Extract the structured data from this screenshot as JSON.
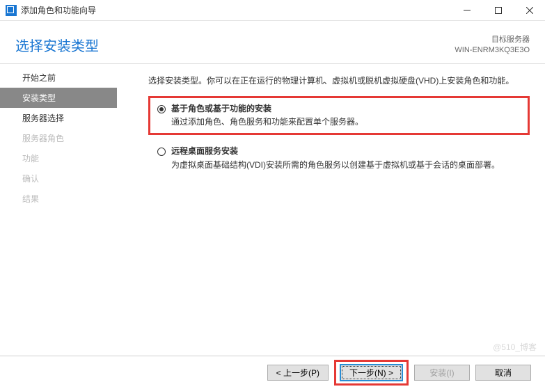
{
  "titlebar": {
    "title": "添加角色和功能向导"
  },
  "header": {
    "title": "选择安装类型",
    "server_label": "目标服务器",
    "server_name": "WIN-ENRM3KQ3E3O"
  },
  "sidebar": {
    "items": [
      {
        "label": "开始之前",
        "state": "enabled"
      },
      {
        "label": "安装类型",
        "state": "active"
      },
      {
        "label": "服务器选择",
        "state": "enabled"
      },
      {
        "label": "服务器角色",
        "state": "disabled"
      },
      {
        "label": "功能",
        "state": "disabled"
      },
      {
        "label": "确认",
        "state": "disabled"
      },
      {
        "label": "结果",
        "state": "disabled"
      }
    ]
  },
  "main": {
    "intro": "选择安装类型。你可以在正在运行的物理计算机、虚拟机或脱机虚拟硬盘(VHD)上安装角色和功能。",
    "options": [
      {
        "title": "基于角色或基于功能的安装",
        "desc": "通过添加角色、角色服务和功能来配置单个服务器。",
        "checked": true,
        "highlighted": true
      },
      {
        "title": "远程桌面服务安装",
        "desc": "为虚拟桌面基础结构(VDI)安装所需的角色服务以创建基于虚拟机或基于会话的桌面部署。",
        "checked": false,
        "highlighted": false
      }
    ]
  },
  "footer": {
    "prev": "< 上一步(P)",
    "next": "下一步(N) >",
    "install": "安装(I)",
    "cancel": "取消"
  },
  "watermark": "@510_博客"
}
